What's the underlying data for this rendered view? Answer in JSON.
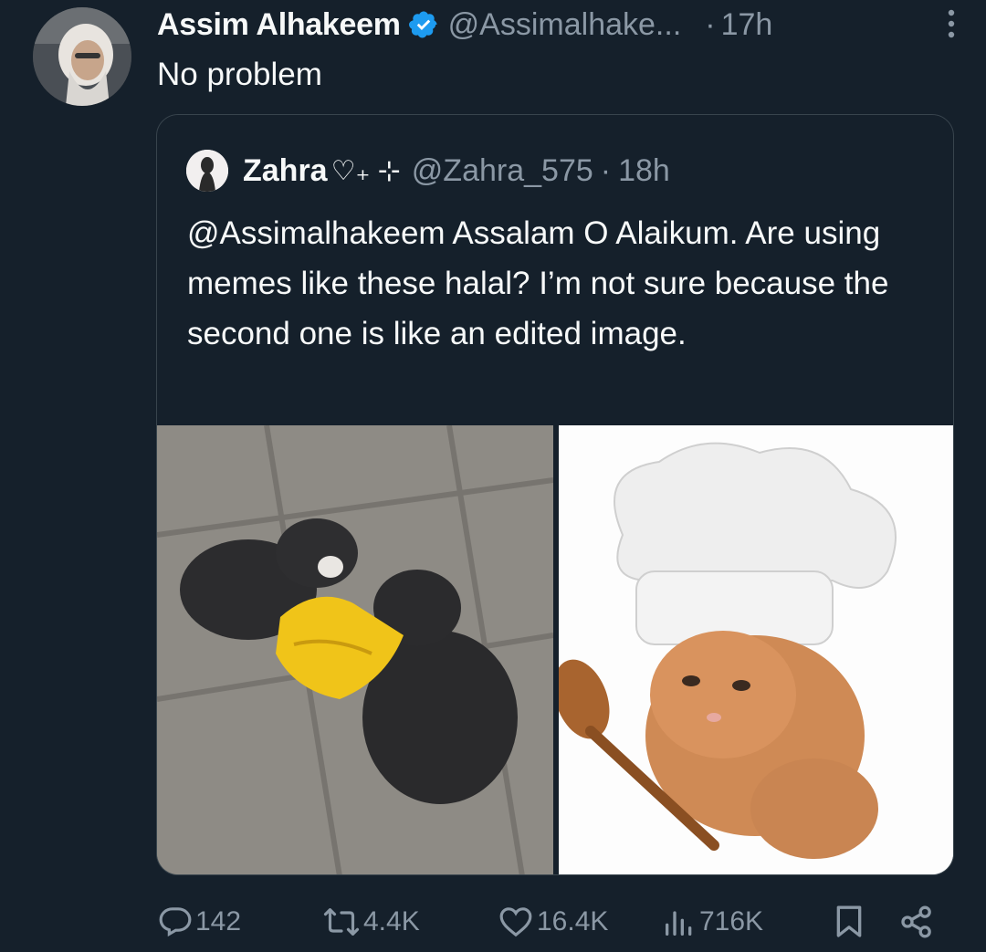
{
  "tweet": {
    "author_name": "Assim Alhakeem",
    "handle": "@Assimalhake...",
    "separator": "·",
    "time": "17h",
    "text": "No problem"
  },
  "quoted": {
    "author_name": "Zahra",
    "name_symbols": "♡₊ ⊹",
    "handle": "@Zahra_575",
    "separator": "·",
    "time": "18h",
    "text": "@Assimalhakeem Assalam O Alaikum.  Are using memes like these halal?  I’m not sure because the second one is like an edited image."
  },
  "actions": {
    "replies": "142",
    "reposts": "4.4K",
    "likes": "16.4K",
    "views": "716K"
  },
  "colors": {
    "background": "#15202b",
    "text": "#f7f9f9",
    "muted": "#8b98a5",
    "verified": "#1d9bf0",
    "border": "#38444d"
  }
}
